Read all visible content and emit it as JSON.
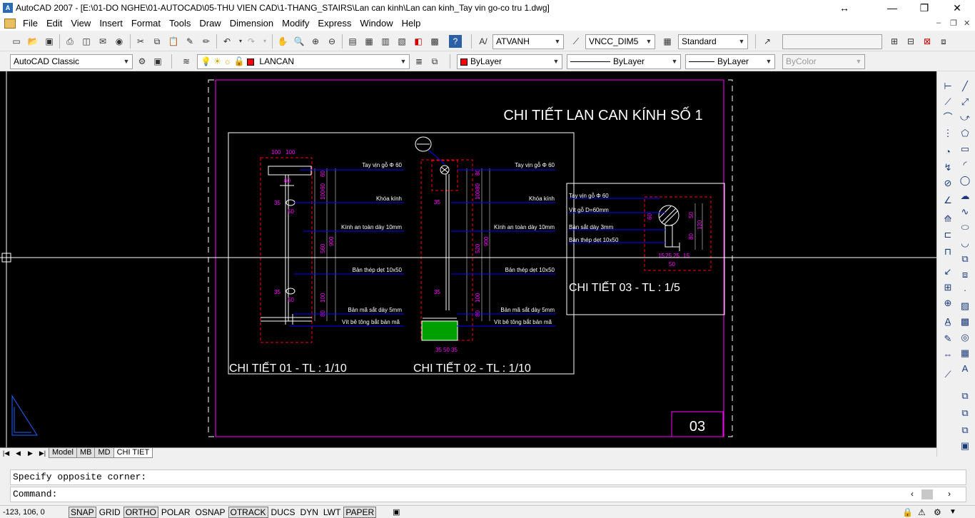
{
  "window": {
    "title": "AutoCAD 2007 - [E:\\01-DO NGHE\\01-AUTOCAD\\05-THU VIEN CAD\\1-THANG_STAIRS\\Lan can kinh\\Lan can kinh_Tay vin go-co tru 1.dwg]",
    "app_icon_text": "A"
  },
  "menu": [
    "File",
    "Edit",
    "View",
    "Insert",
    "Format",
    "Tools",
    "Draw",
    "Dimension",
    "Modify",
    "Express",
    "Window",
    "Help"
  ],
  "toolbar1": {
    "text_style": "ATVANH",
    "dim_style": "VNCC_DIM5",
    "table_style": "Standard"
  },
  "toolbar2": {
    "workspace": "AutoCAD Classic",
    "layer": "LANCAN",
    "color": "ByLayer",
    "linetype": "ByLayer",
    "lineweight": "ByLayer",
    "plot_style": "ByColor",
    "color_swatch": "#ff0000"
  },
  "drawing": {
    "main_title": "CHI TIẾT LAN CAN KÍNH SỐ 1",
    "sheet_number": "03",
    "detail1_title": "CHI TIẾT 01 - TL : 1/10",
    "detail2_title": "CHI TIẾT 02 - TL : 1/10",
    "detail3_title": "CHI TIẾT 03 - TL : 1/5",
    "d1_labels": [
      "Tay vịn gỗ Φ 60",
      "Khóa kính",
      "Kính an toàn dày 10mm",
      "Bản thép dẹt 10x50",
      "Bản mã sắt dày 5mm",
      "Vít bê tông bắt bản mã"
    ],
    "d2_labels": [
      "Tay vịn gỗ Φ 60",
      "Khóa kính",
      "Kính an toàn dày 10mm",
      "Bản thép dẹt 10x50",
      "Bản mã sắt dày 5mm",
      "Vít bê tông bắt bản mã"
    ],
    "d3_labels": [
      "Tay vịn gỗ Φ 60",
      "Vít gỗ D=60mm",
      "Bản sắt dày 3mm",
      "Bản thép dẹt 10x50"
    ],
    "d1_dims": [
      "100",
      "100",
      "60",
      "35",
      "50",
      "35",
      "50",
      "60",
      "60",
      "100",
      "560",
      "900",
      "100",
      "80"
    ],
    "d2_dims": [
      "80",
      "35",
      "35",
      "80",
      "100",
      "520",
      "900",
      "100",
      "80",
      "35",
      "50",
      "35"
    ],
    "d3_dims": [
      "60",
      "50",
      "120",
      "80",
      "15",
      "25",
      "25",
      "50",
      "15"
    ],
    "colors": {
      "paper_border": "#ff00ff",
      "text": "#ffffff",
      "dim": "#ff00ff",
      "leader": "#0000ff",
      "red_dash": "#ff0000",
      "green": "#00c000"
    }
  },
  "layout_tabs": [
    "Model",
    "MB",
    "MD",
    "CHI TIET"
  ],
  "active_tab": "CHI TIET",
  "command": {
    "history": "Specify opposite corner:",
    "prompt": "Command:"
  },
  "status": {
    "coords": "-123, 106, 0",
    "toggles": [
      {
        "label": "SNAP",
        "on": true
      },
      {
        "label": "GRID",
        "on": false
      },
      {
        "label": "ORTHO",
        "on": true
      },
      {
        "label": "POLAR",
        "on": false
      },
      {
        "label": "OSNAP",
        "on": false
      },
      {
        "label": "OTRACK",
        "on": true
      },
      {
        "label": "DUCS",
        "on": false
      },
      {
        "label": "DYN",
        "on": false
      },
      {
        "label": "LWT",
        "on": false
      },
      {
        "label": "PAPER",
        "on": true
      }
    ]
  },
  "icons": {
    "toolbar1": [
      "new-icon",
      "open-icon",
      "save-icon",
      "plot-icon",
      "plot-preview-icon",
      "publish-icon",
      "3dwf-icon",
      "cut-icon",
      "copy-icon",
      "paste-icon",
      "matchprop-icon",
      "block-editor-icon",
      "undo-icon",
      "redo-icon",
      "pan-icon",
      "zoom-realtime-icon",
      "zoom-window-icon",
      "zoom-previous-icon",
      "properties-icon",
      "designcenter-icon",
      "tool-palettes-icon",
      "sheet-set-icon",
      "markup-icon",
      "quickcalc-icon",
      "help-icon"
    ],
    "right": [
      "line-icon",
      "construction-line-icon",
      "polyline-icon",
      "polygon-icon",
      "rectangle-icon",
      "arc-icon",
      "circle-icon",
      "revcloud-icon",
      "spline-icon",
      "ellipse-icon",
      "ellipse-arc-icon",
      "insert-block-icon",
      "make-block-icon",
      "point-icon",
      "hatch-icon",
      "gradient-icon",
      "region-icon",
      "table-icon",
      "multiline-text-icon"
    ]
  }
}
